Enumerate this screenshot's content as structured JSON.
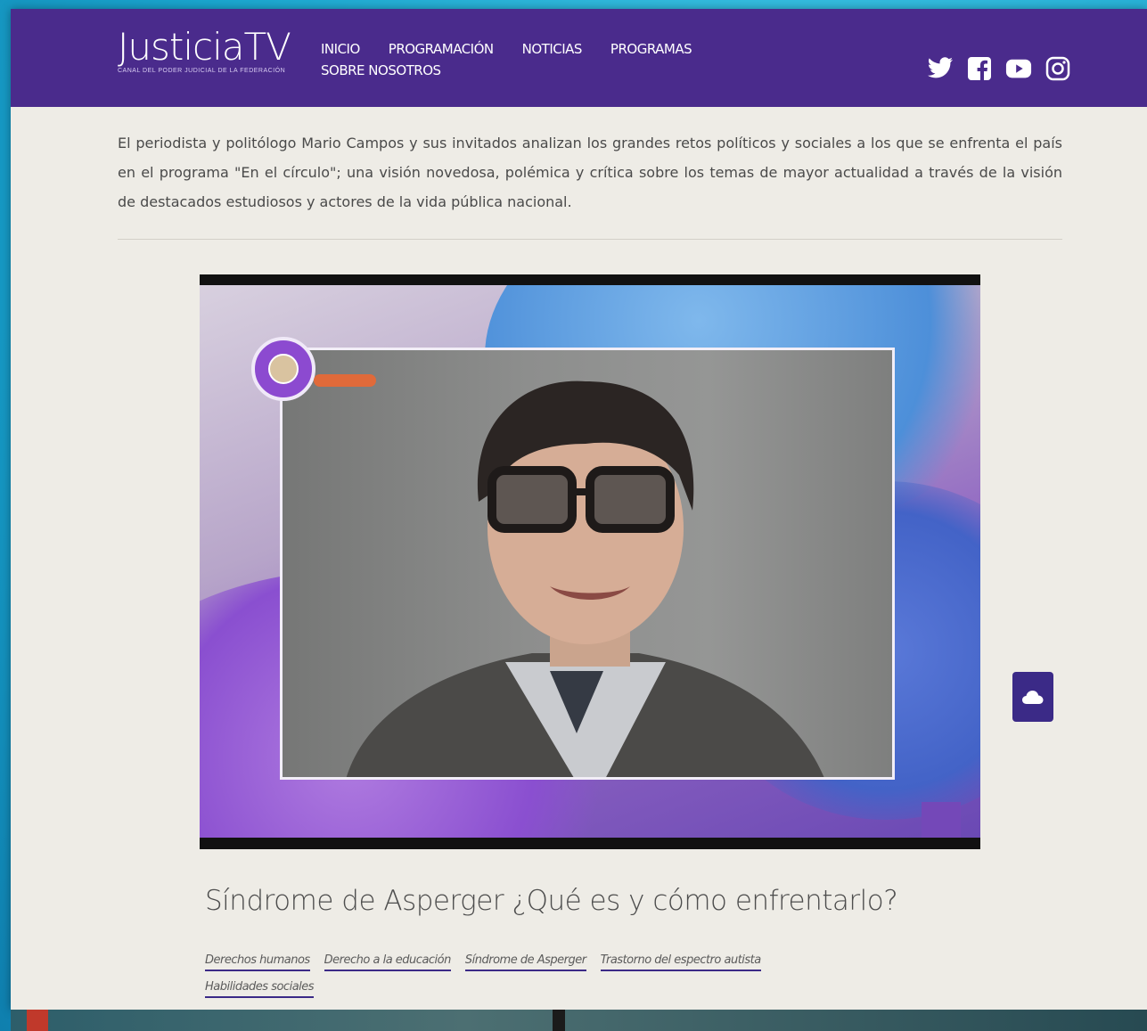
{
  "brand": {
    "logo_text": "JusticiaTV",
    "tagline": "CANAL DEL PODER JUDICIAL DE LA FEDERACIÓN"
  },
  "nav": {
    "items": [
      {
        "label": "INICIO"
      },
      {
        "label": "PROGRAMACIÓN"
      },
      {
        "label": "NOTICIAS"
      },
      {
        "label": "PROGRAMAS"
      },
      {
        "label": "SOBRE NOSOTROS"
      }
    ]
  },
  "socials": [
    {
      "icon": "twitter-icon"
    },
    {
      "icon": "facebook-icon"
    },
    {
      "icon": "youtube-icon"
    },
    {
      "icon": "instagram-icon"
    }
  ],
  "program": {
    "description": "El periodista y politólogo Mario Campos y sus invitados analizan los grandes retos políticos y sociales a los que se enfrenta el país en el programa \"En el círculo\"; una visión novedosa, polémica y crítica sobre los temas de mayor actualidad a través de la visión de destacados estudiosos y actores de la vida pública nacional."
  },
  "video": {
    "title": "Síndrome de Asperger ¿Qué es y cómo enfrentarlo?"
  },
  "tags": [
    "Derechos humanos",
    "Derecho a la educación",
    "Síndrome de Asperger",
    "Trastorno del espectro autista",
    "Habilidades sociales"
  ],
  "colors": {
    "navbar": "#4a2b8c",
    "accent": "#3b2a87",
    "page_bg": "#eeece6"
  }
}
